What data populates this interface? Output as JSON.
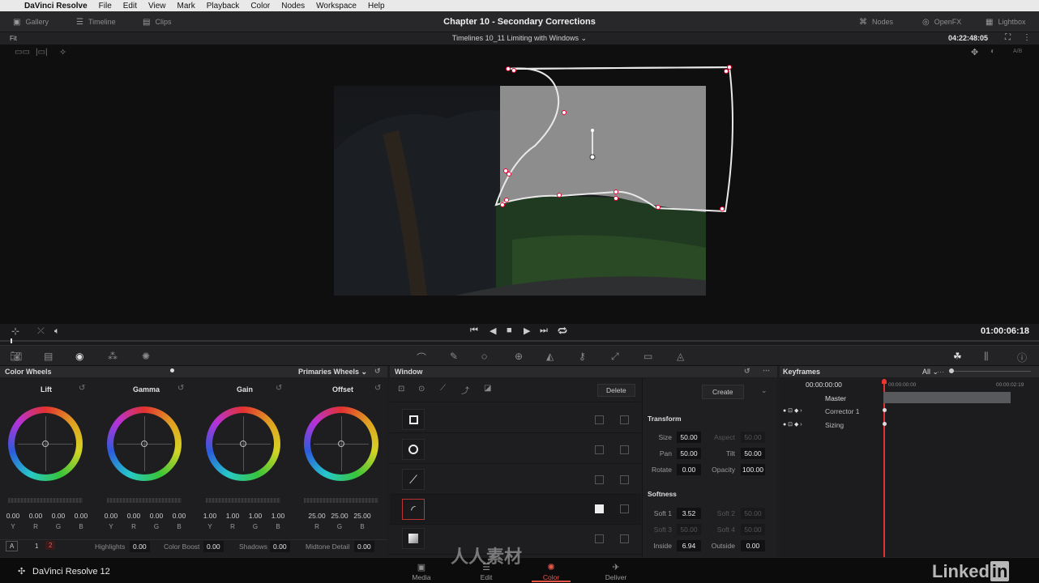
{
  "menubar": {
    "apple": "",
    "app": "DaVinci Resolve",
    "items": [
      "File",
      "Edit",
      "View",
      "Mark",
      "Playback",
      "Color",
      "Nodes",
      "Workspace",
      "Help"
    ]
  },
  "topbar": {
    "title": "Chapter 10 - Secondary Corrections",
    "left_tabs": [
      "Gallery",
      "Timeline",
      "Clips"
    ],
    "right_tabs": [
      "Nodes",
      "OpenFX",
      "Lightbox"
    ]
  },
  "viewbar": {
    "fit": "Fit",
    "timeline_name": "Timelines 10_11 Limiting with Windows",
    "timecode": "04:22:48:05",
    "ab": "A/B"
  },
  "transport": {
    "timecode": "01:00:06:18"
  },
  "color_wheels": {
    "title": "Color Wheels",
    "mode": "Primaries Wheels",
    "wheels": [
      {
        "name": "Lift",
        "values": [
          "0.00",
          "0.00",
          "0.00",
          "0.00"
        ],
        "channels": [
          "Y",
          "R",
          "G",
          "B"
        ]
      },
      {
        "name": "Gamma",
        "values": [
          "0.00",
          "0.00",
          "0.00",
          "0.00"
        ],
        "channels": [
          "Y",
          "R",
          "G",
          "B"
        ]
      },
      {
        "name": "Gain",
        "values": [
          "1.00",
          "1.00",
          "1.00",
          "1.00"
        ],
        "channels": [
          "Y",
          "R",
          "G",
          "B"
        ]
      },
      {
        "name": "Offset",
        "values": [
          "25.00",
          "25.00",
          "25.00"
        ],
        "channels": [
          "R",
          "G",
          "B"
        ]
      }
    ],
    "footer": {
      "mode_a": "A",
      "page1": "1",
      "page2": "2",
      "highlights_label": "Highlights",
      "highlights_value": "0.00",
      "color_boost_label": "Color Boost",
      "color_boost_value": "0.00",
      "shadows_label": "Shadows",
      "shadows_value": "0.00",
      "midtone_label": "Midtone Detail",
      "midtone_value": "0.00"
    }
  },
  "window": {
    "title": "Window",
    "delete": "Delete",
    "create": "Create",
    "shapes": [
      "square",
      "circle",
      "linear",
      "curve",
      "gradient"
    ],
    "transform_label": "Transform",
    "size_label": "Size",
    "size_value": "50.00",
    "aspect_label": "Aspect",
    "aspect_value": "50.00",
    "pan_label": "Pan",
    "pan_value": "50.00",
    "tilt_label": "Tilt",
    "tilt_value": "50.00",
    "rotate_label": "Rotate",
    "rotate_value": "0.00",
    "opacity_label": "Opacity",
    "opacity_value": "100.00",
    "softness_label": "Softness",
    "soft1_label": "Soft 1",
    "soft1_value": "3.52",
    "soft2_label": "Soft 2",
    "soft2_value": "50.00",
    "soft3_label": "Soft 3",
    "soft3_value": "50.00",
    "soft4_label": "Soft 4",
    "soft4_value": "50.00",
    "inside_label": "Inside",
    "inside_value": "6.94",
    "outside_label": "Outside",
    "outside_value": "0.00"
  },
  "keyframes": {
    "title": "Keyframes",
    "filter": "All",
    "current_tc": "00:00:00:00",
    "start_tc": "00:00:00:00",
    "end_tc": "00:00:02:19",
    "tracks": [
      "Master",
      "Corrector 1",
      "Sizing"
    ]
  },
  "pages": {
    "brand": "DaVinci Resolve 12",
    "tabs": [
      "Media",
      "Edit",
      "Color",
      "Deliver"
    ],
    "active": "Color"
  },
  "watermark": {
    "linkedin": "Linked",
    "in": "in",
    "site_text": "人人素材"
  }
}
